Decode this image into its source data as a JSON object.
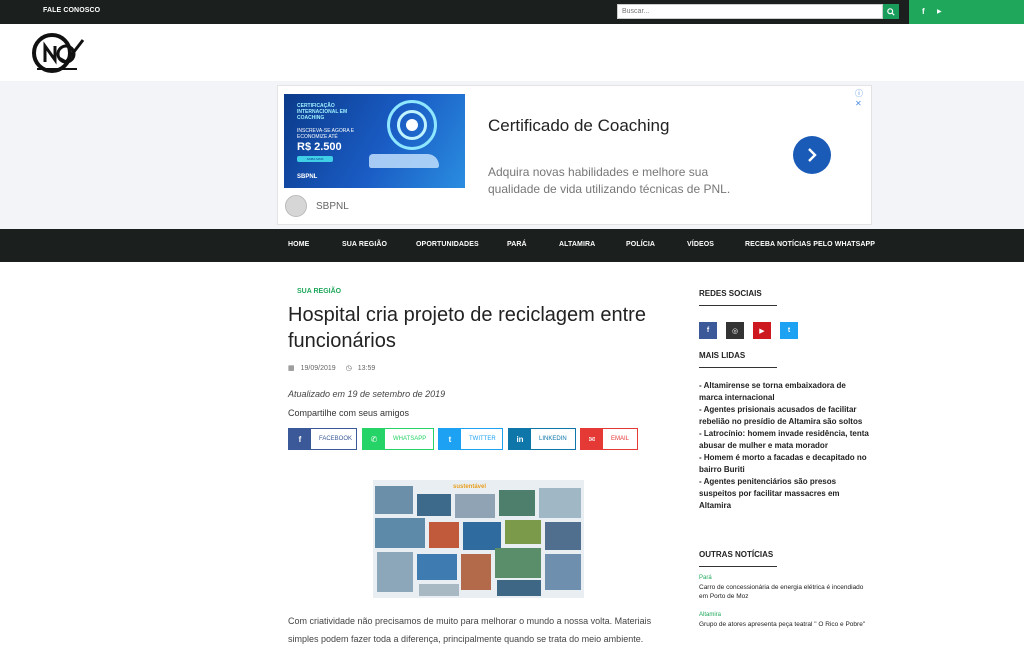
{
  "topbar": {
    "contact_label": "FALE CONOSCO",
    "search_placeholder": "Buscar...",
    "search_icon": "search-icon",
    "social": {
      "facebook": "f",
      "youtube": "▶"
    }
  },
  "ad": {
    "image_text": {
      "line1": "CERTIFICAÇÃO INTERNACIONAL EM COACHING",
      "line2": "INSCREVA-SE AGORA E ECONOMIZE ATÉ",
      "price": "R$ 2.500",
      "cta": "SAIBA MAIS",
      "logo": "SBPNL"
    },
    "title": "Certificado de Coaching",
    "description": "Adquira novas habilidades e melhore sua qualidade de vida utilizando técnicas de PNL.",
    "brand": "SBPNL",
    "choices": "ⓘ ✕"
  },
  "nav": {
    "items": [
      "HOME",
      "SUA REGIÃO",
      "OPORTUNIDADES",
      "PARÁ",
      "ALTAMIRA",
      "POLÍCIA",
      "VÍDEOS",
      "RECEBA NOTÍCIAS PELO WHATSAPP"
    ]
  },
  "article": {
    "category": "SUA REGIÃO",
    "title": "Hospital cria projeto de reciclagem entre funcionários",
    "date": "19/09/2019",
    "time": "13:59",
    "updated": "Atualizado em 19 de setembro de 2019",
    "share_label": "Compartilhe com seus amigos",
    "share": [
      {
        "label": "FACEBOOK",
        "icon": "f",
        "color": "#3b5998"
      },
      {
        "label": "WHATSAPP",
        "icon": "✆",
        "color": "#25d366"
      },
      {
        "label": "TWITTER",
        "icon": "t",
        "color": "#1da1f2"
      },
      {
        "label": "LINKEDIN",
        "icon": "in",
        "color": "#0e76a8"
      },
      {
        "label": "EMAIL",
        "icon": "✉",
        "color": "#e53935"
      }
    ],
    "photo_caption": "sustentável",
    "body": "Com criatividade não precisamos de muito para melhorar o mundo a nossa volta. Materiais simples podem fazer toda a diferença, principalmente quando se trata do meio ambiente."
  },
  "sidebar": {
    "social_heading": "REDES SOCIAIS",
    "social_buttons": [
      {
        "icon": "f",
        "color": "#3b5998"
      },
      {
        "icon": "◎",
        "color": "#333333"
      },
      {
        "icon": "▶",
        "color": "#cc181e"
      },
      {
        "icon": "t",
        "color": "#1da1f2"
      }
    ],
    "most_read_heading": "MAIS LIDAS",
    "most_read": [
      "- Altamirense se torna embaixadora de marca internacional",
      "- Agentes prisionais acusados de facilitar rebelião no presídio de Altamira são soltos",
      "- Latrocínio: homem invade residência, tenta abusar de mulher e mata morador",
      "- Homem é morto a facadas e decapitado no bairro Buriti",
      "- Agentes penitenciários são presos suspeitos por facilitar massacres em Altamira"
    ],
    "other_heading": "OUTRAS NOTÍCIAS",
    "other_news": [
      {
        "category": "Pará",
        "title": "Carro de concessionária de energia elétrica é incendiado em Porto de Moz"
      },
      {
        "category": "Altamira",
        "title": "Grupo de atores apresenta peça teatral \" O Rico e Pobre\""
      }
    ]
  }
}
